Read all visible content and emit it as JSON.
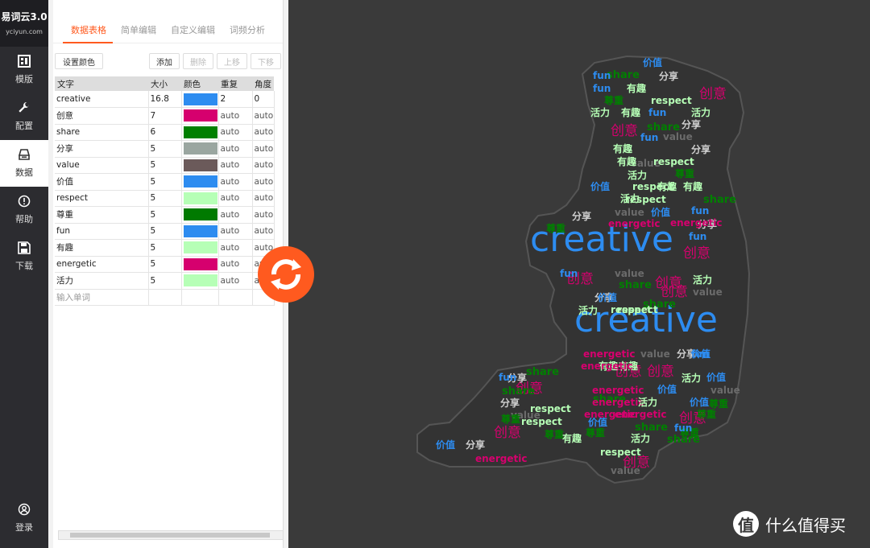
{
  "app": {
    "title": "易词云3.0",
    "domain": "yciyun.com"
  },
  "nav": [
    {
      "label": "模版",
      "icon": "template-icon"
    },
    {
      "label": "配置",
      "icon": "wrench-icon"
    },
    {
      "label": "数据",
      "icon": "data-icon"
    },
    {
      "label": "帮助",
      "icon": "help-icon"
    },
    {
      "label": "下载",
      "icon": "save-icon"
    }
  ],
  "login": {
    "label": "登录"
  },
  "tabs": [
    "数据表格",
    "简单编辑",
    "自定义编辑",
    "词频分析"
  ],
  "toolbar": {
    "set_color": "设置颜色",
    "add": "添加",
    "delete": "删除",
    "up": "上移",
    "down": "下移"
  },
  "table": {
    "headers": [
      "文字",
      "大小",
      "颜色",
      "重复",
      "角度"
    ],
    "rows": [
      {
        "word": "creative",
        "size": "16.8",
        "color": "#2d8cf0",
        "repeat": "2",
        "angle": "0"
      },
      {
        "word": "创意",
        "size": "7",
        "color": "#d6006e",
        "repeat": "auto",
        "angle": "auto"
      },
      {
        "word": "share",
        "size": "6",
        "color": "#008000",
        "repeat": "auto",
        "angle": "auto"
      },
      {
        "word": "分享",
        "size": "5",
        "color": "#9aa6a0",
        "repeat": "auto",
        "angle": "auto"
      },
      {
        "word": "value",
        "size": "5",
        "color": "#6b5a5a",
        "repeat": "auto",
        "angle": "auto"
      },
      {
        "word": "价值",
        "size": "5",
        "color": "#2d8cf0",
        "repeat": "auto",
        "angle": "auto"
      },
      {
        "word": "respect",
        "size": "5",
        "color": "#b6ffb6",
        "repeat": "auto",
        "angle": "auto"
      },
      {
        "word": "尊重",
        "size": "5",
        "color": "#007a00",
        "repeat": "auto",
        "angle": "auto"
      },
      {
        "word": "fun",
        "size": "5",
        "color": "#2d8cf0",
        "repeat": "auto",
        "angle": "auto"
      },
      {
        "word": "有趣",
        "size": "5",
        "color": "#b6ffb6",
        "repeat": "auto",
        "angle": "auto"
      },
      {
        "word": "energetic",
        "size": "5",
        "color": "#d6006e",
        "repeat": "auto",
        "angle": "auto"
      },
      {
        "word": "活力",
        "size": "5",
        "color": "#b6ffb6",
        "repeat": "auto",
        "angle": "auto"
      }
    ],
    "input_placeholder": "输入单词"
  },
  "watermark": {
    "symbol": "值",
    "text": "什么值得买"
  },
  "cloud_colors": {
    "creative": "#2d8cf0",
    "创意": "#d6006e",
    "share": "#008000",
    "分享": "#cfcfcf",
    "value": "#6b6b6b",
    "价值": "#2d8cf0",
    "respect": "#b6ffb6",
    "尊重": "#008000",
    "fun": "#2d8cf0",
    "有趣": "#b6ffb6",
    "energetic": "#d6006e",
    "活力": "#b6ffb6"
  },
  "cloud_words": [
    {
      "t": "creative",
      "s": 44
    },
    {
      "t": "creative",
      "s": 44
    },
    {
      "t": "创意",
      "s": 17
    },
    {
      "t": "创意",
      "s": 17
    },
    {
      "t": "创意",
      "s": 17
    },
    {
      "t": "创意",
      "s": 17
    },
    {
      "t": "创意",
      "s": 17
    },
    {
      "t": "创意",
      "s": 17
    },
    {
      "t": "创意",
      "s": 17
    },
    {
      "t": "创意",
      "s": 17
    },
    {
      "t": "创意",
      "s": 17
    },
    {
      "t": "创意",
      "s": 17
    },
    {
      "t": "创意",
      "s": 17
    },
    {
      "t": "创意",
      "s": 17
    },
    {
      "t": "share",
      "s": 13
    },
    {
      "t": "share",
      "s": 13
    },
    {
      "t": "share",
      "s": 13
    },
    {
      "t": "share",
      "s": 13
    },
    {
      "t": "share",
      "s": 13
    },
    {
      "t": "share",
      "s": 13
    },
    {
      "t": "share",
      "s": 13
    },
    {
      "t": "share",
      "s": 13
    },
    {
      "t": "share",
      "s": 13
    },
    {
      "t": "share",
      "s": 13
    },
    {
      "t": "分享",
      "s": 12
    },
    {
      "t": "分享",
      "s": 12
    },
    {
      "t": "分享",
      "s": 12
    },
    {
      "t": "分享",
      "s": 12
    },
    {
      "t": "分享",
      "s": 12
    },
    {
      "t": "分享",
      "s": 12
    },
    {
      "t": "分享",
      "s": 12
    },
    {
      "t": "分享",
      "s": 12
    },
    {
      "t": "分享",
      "s": 12
    },
    {
      "t": "分享",
      "s": 12
    },
    {
      "t": "value",
      "s": 12
    },
    {
      "t": "value",
      "s": 12
    },
    {
      "t": "value",
      "s": 12
    },
    {
      "t": "value",
      "s": 12
    },
    {
      "t": "value",
      "s": 12
    },
    {
      "t": "value",
      "s": 12
    },
    {
      "t": "value",
      "s": 12
    },
    {
      "t": "value",
      "s": 12
    },
    {
      "t": "value",
      "s": 12
    },
    {
      "t": "价值",
      "s": 12
    },
    {
      "t": "价值",
      "s": 12
    },
    {
      "t": "价值",
      "s": 12
    },
    {
      "t": "价值",
      "s": 12
    },
    {
      "t": "价值",
      "s": 12
    },
    {
      "t": "价值",
      "s": 12
    },
    {
      "t": "价值",
      "s": 12
    },
    {
      "t": "价值",
      "s": 12
    },
    {
      "t": "价值",
      "s": 12
    },
    {
      "t": "价值",
      "s": 12
    },
    {
      "t": "respect",
      "s": 12
    },
    {
      "t": "respect",
      "s": 12
    },
    {
      "t": "respect",
      "s": 12
    },
    {
      "t": "respect",
      "s": 12
    },
    {
      "t": "respect",
      "s": 12
    },
    {
      "t": "respect",
      "s": 12
    },
    {
      "t": "respect",
      "s": 12
    },
    {
      "t": "respect",
      "s": 12
    },
    {
      "t": "respect",
      "s": 12
    },
    {
      "t": "尊重",
      "s": 12
    },
    {
      "t": "尊重",
      "s": 12
    },
    {
      "t": "尊重",
      "s": 12
    },
    {
      "t": "尊重",
      "s": 12
    },
    {
      "t": "尊重",
      "s": 12
    },
    {
      "t": "尊重",
      "s": 12
    },
    {
      "t": "尊重",
      "s": 12
    },
    {
      "t": "尊重",
      "s": 12
    },
    {
      "t": "尊重",
      "s": 12
    },
    {
      "t": "fun",
      "s": 12
    },
    {
      "t": "fun",
      "s": 12
    },
    {
      "t": "fun",
      "s": 12
    },
    {
      "t": "fun",
      "s": 12
    },
    {
      "t": "fun",
      "s": 12
    },
    {
      "t": "fun",
      "s": 12
    },
    {
      "t": "fun",
      "s": 12
    },
    {
      "t": "fun",
      "s": 12
    },
    {
      "t": "fun",
      "s": 12
    },
    {
      "t": "fun",
      "s": 12
    },
    {
      "t": "有趣",
      "s": 12
    },
    {
      "t": "有趣",
      "s": 12
    },
    {
      "t": "有趣",
      "s": 12
    },
    {
      "t": "有趣",
      "s": 12
    },
    {
      "t": "有趣",
      "s": 12
    },
    {
      "t": "有趣",
      "s": 12
    },
    {
      "t": "有趣",
      "s": 12
    },
    {
      "t": "有趣",
      "s": 12
    },
    {
      "t": "有趣",
      "s": 12
    },
    {
      "t": "energetic",
      "s": 12
    },
    {
      "t": "energetic",
      "s": 12
    },
    {
      "t": "energetic",
      "s": 12
    },
    {
      "t": "energetic",
      "s": 12
    },
    {
      "t": "energetic",
      "s": 12
    },
    {
      "t": "energetic",
      "s": 12
    },
    {
      "t": "energetic",
      "s": 12
    },
    {
      "t": "energetic",
      "s": 12
    },
    {
      "t": "energetic",
      "s": 12
    },
    {
      "t": "活力",
      "s": 12
    },
    {
      "t": "活力",
      "s": 12
    },
    {
      "t": "活力",
      "s": 12
    },
    {
      "t": "活力",
      "s": 12
    },
    {
      "t": "活力",
      "s": 12
    },
    {
      "t": "活力",
      "s": 12
    },
    {
      "t": "活力",
      "s": 12
    },
    {
      "t": "活力",
      "s": 12
    },
    {
      "t": "活力",
      "s": 12
    }
  ]
}
